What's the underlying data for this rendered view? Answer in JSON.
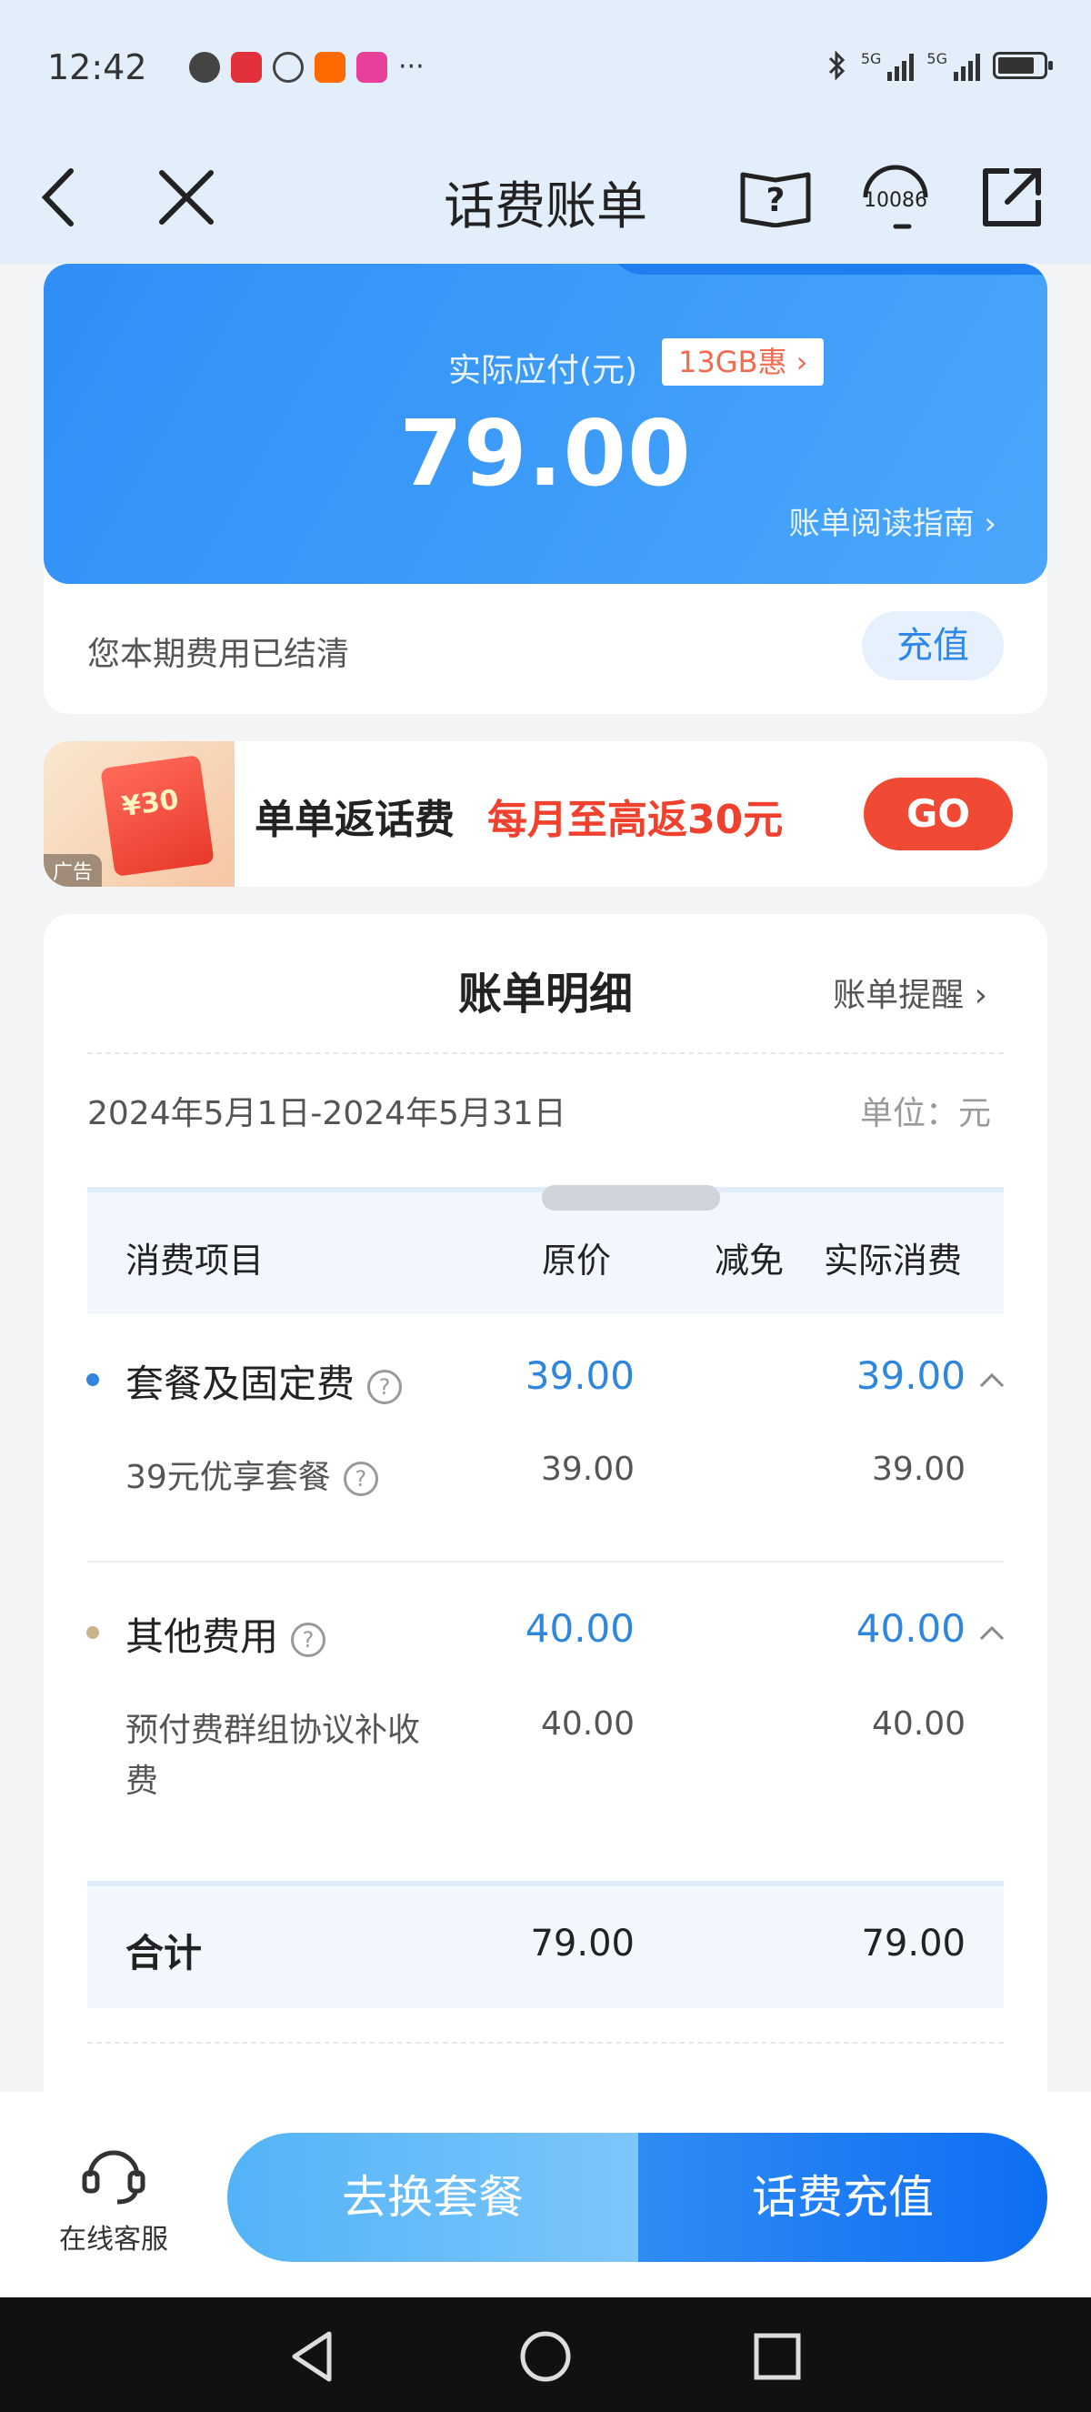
{
  "status_bar": {
    "time": "12:42",
    "signal_label_1": "5G",
    "signal_label_2": "5G"
  },
  "header": {
    "title": "话费账单",
    "service_number": "10086"
  },
  "summary": {
    "amount_label": "实际应付(元)",
    "promo_tag": "13GB惠 ›",
    "amount": "79.00",
    "guide_link": "账单阅读指南 ›",
    "settled_text": "您本期费用已结清",
    "recharge_label": "充值"
  },
  "ad": {
    "image_text": "¥30",
    "tag": "广告",
    "headline": "单单返话费",
    "highlight": "每月至高返30元",
    "go_label": "GO"
  },
  "bill": {
    "title": "账单明细",
    "reminder_link": "账单提醒 ›",
    "period": "2024年5月1日-2024年5月31日",
    "unit": "单位：元",
    "columns": [
      "消费项目",
      "原价",
      "减免",
      "实际消费"
    ],
    "categories": [
      {
        "name": "套餐及固定费",
        "original": "39.00",
        "discount": "",
        "actual": "39.00",
        "dot_color": "#2f86dc",
        "items": [
          {
            "name": "39元优享套餐",
            "original": "39.00",
            "discount": "",
            "actual": "39.00"
          }
        ]
      },
      {
        "name": "其他费用",
        "original": "40.00",
        "discount": "",
        "actual": "40.00",
        "dot_color": "#c9b48a",
        "items": [
          {
            "name_line1": "预付费群组协议补收",
            "name_line2": "费",
            "original": "40.00",
            "discount": "",
            "actual": "40.00"
          }
        ]
      }
    ],
    "total": {
      "label": "合计",
      "original": "79.00",
      "actual": "79.00"
    }
  },
  "bottom": {
    "service_label": "在线客服",
    "change_plan": "去换套餐",
    "recharge": "话费充值"
  },
  "colors": {
    "accent_blue": "#2f86dc",
    "promo_red": "#f0412e",
    "header_bg": "#e3eefb"
  }
}
